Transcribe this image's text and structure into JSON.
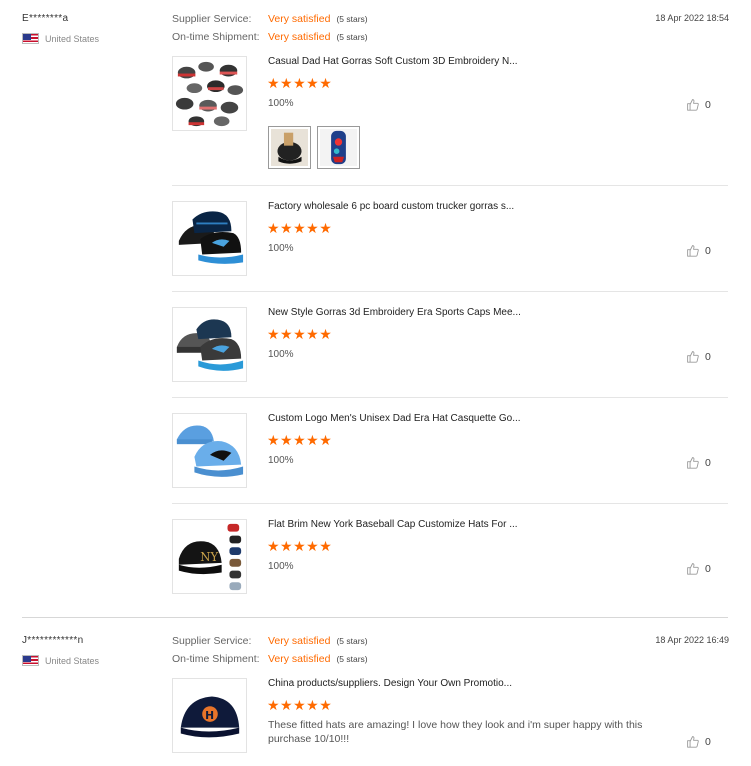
{
  "reviews": [
    {
      "buyer": "E********a",
      "country": "United States",
      "date": "18 Apr 2022 18:54",
      "supplier_service": {
        "label": "Supplier Service:",
        "value": "Very satisfied",
        "stars": "(5 stars)"
      },
      "ontime_shipment": {
        "label": "On-time Shipment:",
        "value": "Very satisfied",
        "stars": "(5 stars)"
      },
      "products": [
        {
          "title": "Casual Dad Hat Gorras Soft Custom 3D Embroidery N...",
          "stars": "★★★★★",
          "rating_text": "100%",
          "likes": "0",
          "image": "hats-grid-icon"
        },
        {
          "title": "Factory wholesale 6 pc board custom trucker gorras s...",
          "stars": "★★★★★",
          "rating_text": "100%",
          "likes": "0",
          "image": "panther-caps-black-icon"
        },
        {
          "title": "New Style Gorras 3d Embroidery Era Sports Caps Mee...",
          "stars": "★★★★★",
          "rating_text": "100%",
          "likes": "0",
          "image": "panther-caps-grey-icon"
        },
        {
          "title": "Custom Logo Men's Unisex Dad Era Hat Casquette Go...",
          "stars": "★★★★★",
          "rating_text": "100%",
          "likes": "0",
          "image": "panther-caps-blue-icon"
        },
        {
          "title": "Flat Brim New York Baseball Cap Customize Hats For ...",
          "stars": "★★★★★",
          "rating_text": "100%",
          "likes": "0",
          "image": "ny-caps-icon"
        }
      ]
    },
    {
      "buyer": "J************n",
      "country": "United States",
      "date": "18 Apr 2022 16:49",
      "supplier_service": {
        "label": "Supplier Service:",
        "value": "Very satisfied",
        "stars": "(5 stars)"
      },
      "ontime_shipment": {
        "label": "On-time Shipment:",
        "value": "Very satisfied",
        "stars": "(5 stars)"
      },
      "products": [
        {
          "title": "China products/suppliers. Design Your Own Promotio...",
          "stars": "★★★★★",
          "comment": "These fitted hats are amazing! I love how they look and i'm super happy with this purchase 10/10!!!",
          "likes": "0",
          "image": "astros-cap-icon"
        }
      ]
    }
  ],
  "colors": {
    "accent": "#ff6a00",
    "flag_red": "#c8102e",
    "flag_blue": "#2b3a8c"
  }
}
